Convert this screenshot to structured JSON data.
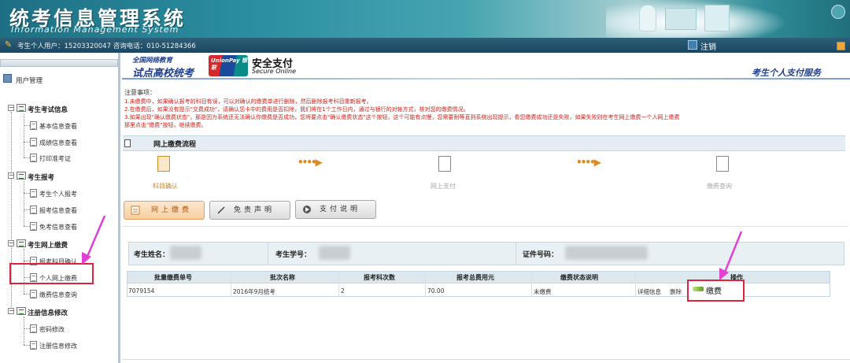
{
  "app": {
    "title_cn": "统考信息管理系统",
    "title_en": "Information Management System"
  },
  "infobar": {
    "user_text": "考生个人用户：15203320047  咨询电话：010-51284366",
    "logout_label": "注销"
  },
  "sidebar": {
    "header_label": "用户管理",
    "groups": [
      {
        "label": "考生考试信息",
        "items": [
          {
            "label": "基本信息查看"
          },
          {
            "label": "成绩信息查看"
          },
          {
            "label": "打印准考证"
          }
        ]
      },
      {
        "label": "考生报考",
        "items": [
          {
            "label": "考生个人报考"
          },
          {
            "label": "报考信息查看"
          },
          {
            "label": "免考信息查看"
          }
        ]
      },
      {
        "label": "考生网上缴费",
        "items": [
          {
            "label": "报考科目确认"
          },
          {
            "label": "个人网上缴费"
          },
          {
            "label": "缴费信息查询"
          }
        ]
      },
      {
        "label": "注册信息修改",
        "items": [
          {
            "label": "密码修改"
          },
          {
            "label": "注册信息修改"
          }
        ]
      }
    ]
  },
  "header": {
    "logo_line1": "全国网络教育",
    "logo_line2": "试点高校统考",
    "unionpay": "UnionPay 银联",
    "secure_cn": "安全支付",
    "secure_en": "Secure Online",
    "service_title": "考生个人支付服务"
  },
  "notes": {
    "title": "注意事项：",
    "lines": [
      "1.未缴费中，如果确认报考的科目有误，可以对确认的缴费单进行删除，然后删除报考科目重新报考。",
      "2.在缴费后，如果没有提示\"交费成功\"，请确认您卡中的费用是否扣除，我们将在1个工作日内，通过与银行的对帐方式，核对您的缴费情况。",
      "3.如果出现\"确认缴费状态\"，那是因为系统还无法确认你缴费是否成功，您将要点击\"确认缴费状态\"这个按钮，这个可能有点慢，您需要耐等直到系统出现提示，看您缴费成功还是失败，如果失败则在考生网上缴费一个人网上缴费",
      "   那里点击\"缴费\"按钮，继续缴费。"
    ]
  },
  "process": {
    "title": "网上缴费流程",
    "steps": [
      {
        "label": "科目确认"
      },
      {
        "label": "网上支付"
      },
      {
        "label": "缴费查询"
      }
    ],
    "arrow": "••••▶"
  },
  "buttons": {
    "pay": "网上缴费",
    "disclaimer": "免责声明",
    "instructions": "支付说明"
  },
  "student": {
    "name_label": "考生姓名：",
    "id_label": "考生学号：",
    "cert_label": "证件号码："
  },
  "table": {
    "headers": [
      "批量缴费单号",
      "批次名称",
      "报考科次数",
      "报考总费用元",
      "缴费状态说明",
      "操作"
    ],
    "rows": [
      {
        "order_no": "7079154",
        "batch": "2016年9月统考",
        "count": "2",
        "total": "70.00",
        "status": "未缴费",
        "detail": "详细信息",
        "delete": "删除",
        "pay": "缴费"
      }
    ]
  },
  "colors": {
    "banner": "#2b8fa1",
    "infobar": "#1b4660",
    "highlight": "#e0223c",
    "arrow": "#e33fd6",
    "note_red": "#d9221a"
  }
}
